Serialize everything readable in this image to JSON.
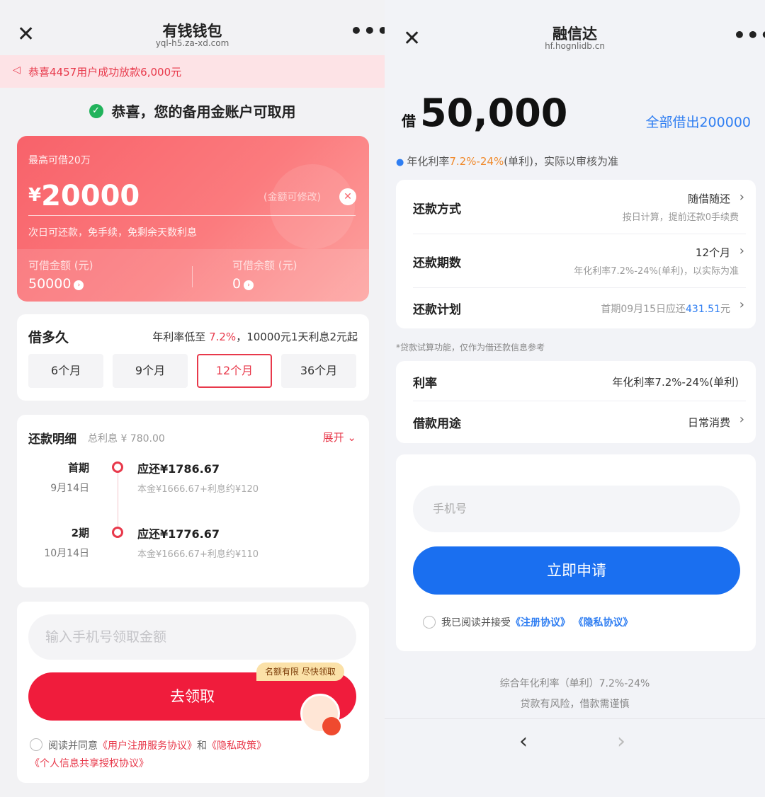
{
  "left": {
    "nav": {
      "close_icon": "close-icon",
      "title": "有钱钱包",
      "url": "yql-h5.za-xd.com",
      "more_icon": "more-icon"
    },
    "banner": {
      "icon": "speaker-icon",
      "text": "恭喜4457用户成功放款6,000元"
    },
    "congrats": {
      "icon": "check-circle-icon",
      "text": "恭喜，您的备用金账户可取用"
    },
    "amount_card": {
      "max_label": "最高可借20万",
      "currency": "¥",
      "amount": "20000",
      "editable_hint": "(金额可修改)",
      "clear_icon": "clear-icon",
      "subtext": "次日可还款，免手续，免剩余天数利息",
      "available_label": "可借金额 (元)",
      "available_value": "50000",
      "balance_label": "可借余额 (元)",
      "balance_value": "0"
    },
    "duration": {
      "title": "借多久",
      "rate_prefix": "年利率低至 ",
      "rate_value": "7.2%",
      "rate_suffix": "，10000元1天利息2元起",
      "terms": [
        "6个月",
        "9个月",
        "12个月",
        "36个月"
      ],
      "selected_term": "12个月"
    },
    "repayment": {
      "title": "还款明细",
      "total_interest": "总利息 ¥ 780.00",
      "expand_label": "展开",
      "periods": [
        {
          "period": "首期",
          "date": "9月14日",
          "due": "应还¥1786.67",
          "detail": "本金¥1666.67+利息约¥120"
        },
        {
          "period": "2期",
          "date": "10月14日",
          "due": "应还¥1776.67",
          "detail": "本金¥1666.67+利息约¥110"
        }
      ]
    },
    "apply": {
      "phone_placeholder": "输入手机号领取金额",
      "tag": "名额有限 尽快领取",
      "button": "去领取",
      "agree_prefix": "阅读并同意",
      "link1": "《用户注册服务协议》",
      "and": "和",
      "link2": "《隐私政策》",
      "link3": "《个人信息共享授权协议》"
    }
  },
  "right": {
    "nav": {
      "close_icon": "close-icon",
      "title": "融信达",
      "url": "hf.hognlidb.cn",
      "more_icon": "more-icon"
    },
    "loan_prefix": "借",
    "loan_amount": "50,000",
    "lend_all": "全部借出200000",
    "rate_line": {
      "prefix": "年化利率",
      "range": "7.2%-24%",
      "suffix": "(单利)，实际以审核为准"
    },
    "details": [
      {
        "key": "还款方式",
        "value": "随借随还",
        "sub": "按日计算，提前还款0手续费"
      },
      {
        "key": "还款期数",
        "value": "12个月",
        "sub": "年化利率7.2%-24%(单利)，以实际为准"
      },
      {
        "key": "还款计划",
        "value_prefix": "首期09月15日应还",
        "value_amount": "431.51",
        "value_suffix": "元"
      }
    ],
    "note": "*贷款试算功能，仅作为借还款信息参考",
    "details2": [
      {
        "key": "利率",
        "value": "年化利率7.2%-24%(单利)"
      },
      {
        "key": "借款用途",
        "value": "日常消费"
      }
    ],
    "phone_placeholder": "手机号",
    "apply_button": "立即申请",
    "agree_prefix": "我已阅读并接受",
    "link1": "《注册协议》",
    "link2": "《隐私协议》",
    "footer1": "综合年化利率（单利）7.2%-24%",
    "footer2": "贷款有风险，借款需谨慎",
    "back_icon": "back-icon",
    "forward_icon": "forward-icon"
  },
  "colors": {
    "left_accent": "#e8394b",
    "right_accent": "#1a6ff0",
    "rate_highlight": "#f08a2c"
  }
}
